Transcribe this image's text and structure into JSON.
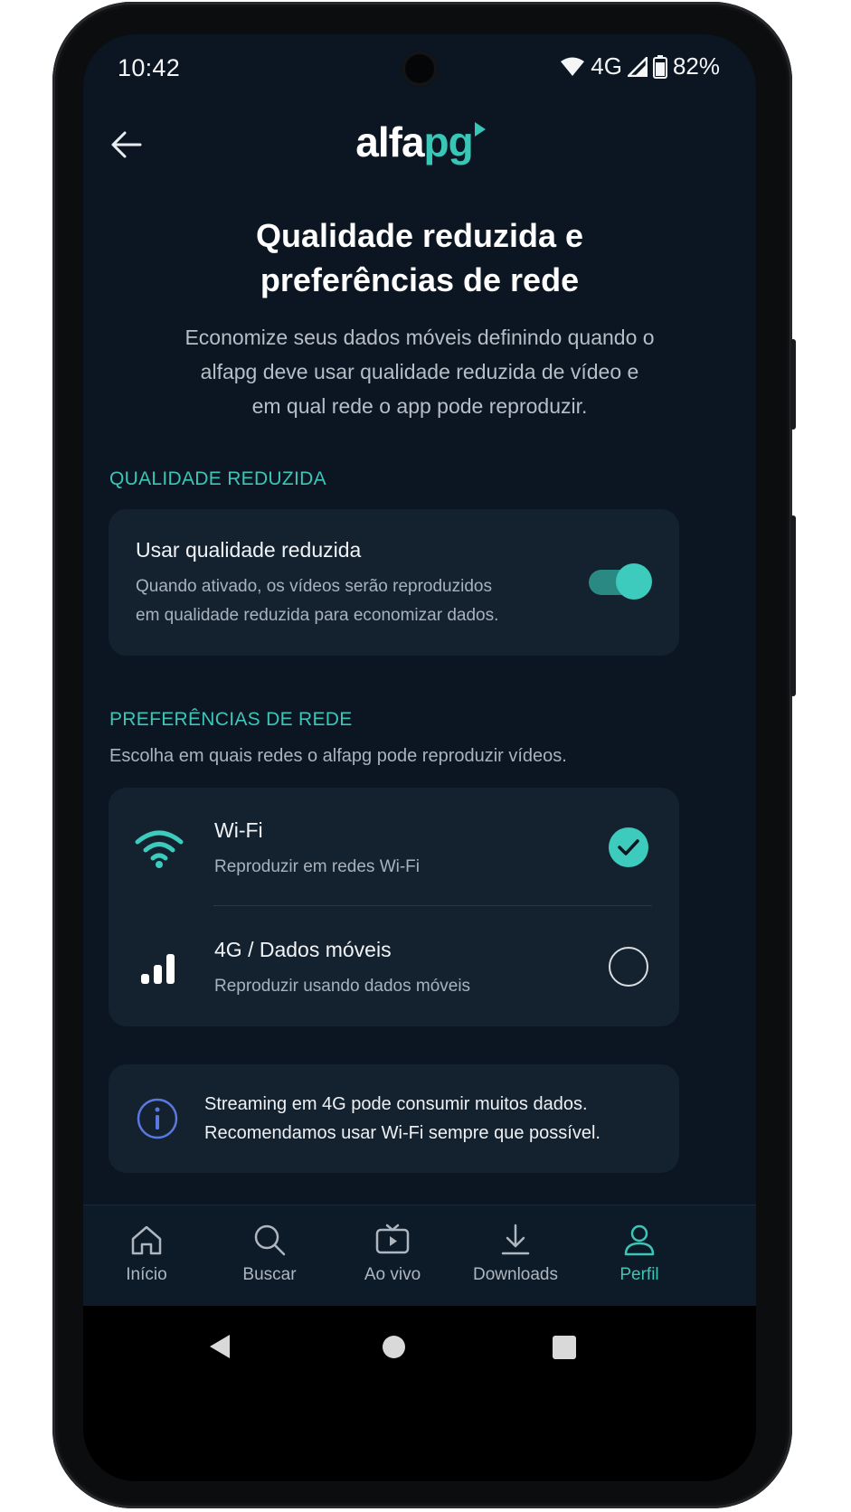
{
  "status_bar": {
    "time": "10:42",
    "network": "4G",
    "battery": "82%"
  },
  "header": {
    "logo_part1": "alfa",
    "logo_part2": "pg",
    "title_line1": "Qualidade reduzida e",
    "title_line2": "preferências de rede",
    "subtitle_line1": "Economize seus dados móveis definindo quando o",
    "subtitle_line2": "alfapg deve usar qualidade reduzida de vídeo e",
    "subtitle_line3": "em qual rede o app pode reproduzir."
  },
  "reduced_quality": {
    "section_label": "QUALIDADE REDUZIDA",
    "toggle_title": "Usar qualidade reduzida",
    "toggle_desc_line1": "Quando ativado, os vídeos serão reproduzidos",
    "toggle_desc_line2": "em qualidade reduzida para economizar dados.",
    "enabled": true
  },
  "network_prefs": {
    "section_label": "PREFERÊNCIAS DE REDE",
    "section_desc": "Escolha em quais redes o alfapg pode reproduzir vídeos.",
    "options": [
      {
        "title": "Wi-Fi",
        "desc": "Reproduzir em redes Wi-Fi",
        "icon": "wifi-icon",
        "selected": true
      },
      {
        "title": "4G / Dados móveis",
        "desc": "Reproduzir usando dados móveis",
        "icon": "signal-bars-icon",
        "selected": false
      }
    ]
  },
  "info": {
    "icon": "info-icon",
    "line1": "Streaming em 4G pode consumir muitos dados.",
    "line2": "Recomendamos usar Wi-Fi sempre que possível."
  },
  "bottom_nav": [
    {
      "label": "Início",
      "icon": "home-icon",
      "active": false
    },
    {
      "label": "Buscar",
      "icon": "search-icon",
      "active": false
    },
    {
      "label": "Ao vivo",
      "icon": "live-tv-icon",
      "active": false
    },
    {
      "label": "Downloads",
      "icon": "download-icon",
      "active": false
    },
    {
      "label": "Perfil",
      "icon": "profile-icon",
      "active": true
    }
  ],
  "colors": {
    "background": "#0b1622",
    "card": "#142230",
    "accent": "#3cc6b8",
    "info_icon": "#5a78e0"
  }
}
